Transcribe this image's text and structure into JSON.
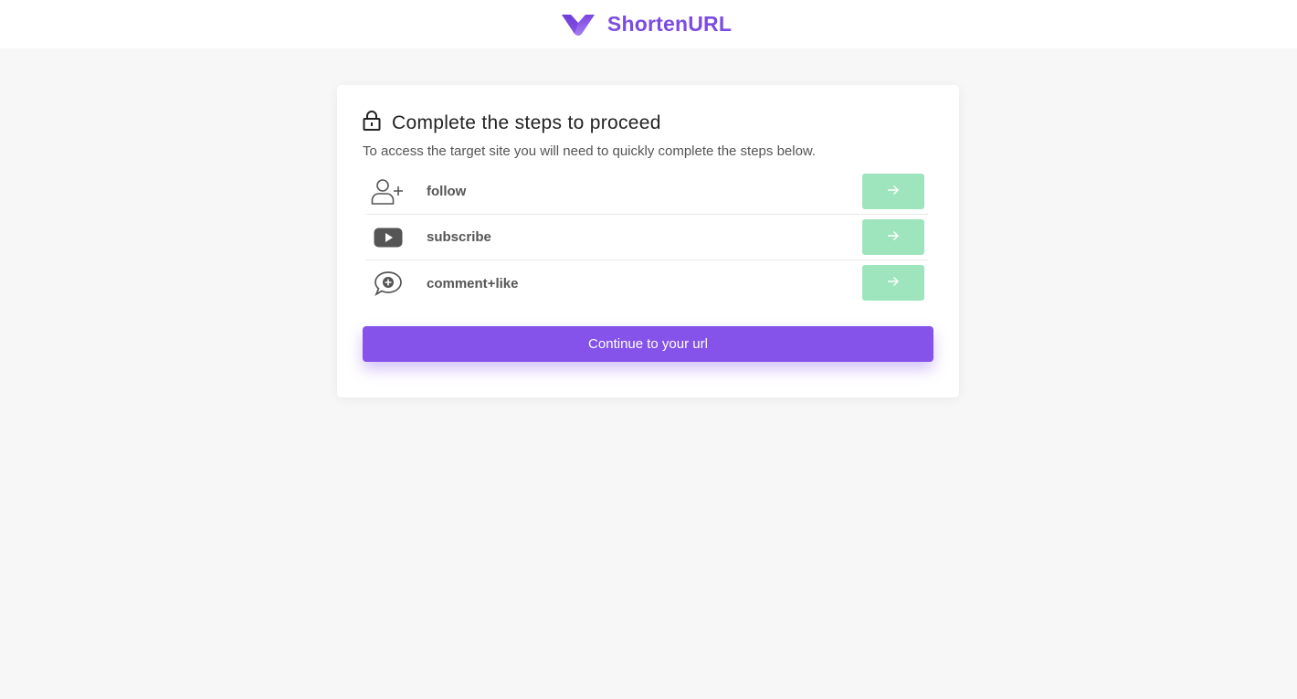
{
  "header": {
    "brand_name": "ShortenURL",
    "logo_icon": "v-shape-logo-icon",
    "brand_color": "#7c4ce0"
  },
  "card": {
    "title": "Complete the steps to proceed",
    "title_icon": "lock-icon",
    "description": "To access the target site you will need to quickly complete the steps below.",
    "steps": [
      {
        "label": "follow",
        "icon": "user-plus-icon",
        "action_icon": "arrow-right-icon"
      },
      {
        "label": "subscribe",
        "icon": "youtube-icon",
        "action_icon": "arrow-right-icon"
      },
      {
        "label": "comment+like",
        "icon": "comment-plus-icon",
        "action_icon": "arrow-right-icon"
      }
    ],
    "step_button_color": "#9ee5bd",
    "continue_label": "Continue to your url",
    "continue_color": "#8552ea"
  }
}
